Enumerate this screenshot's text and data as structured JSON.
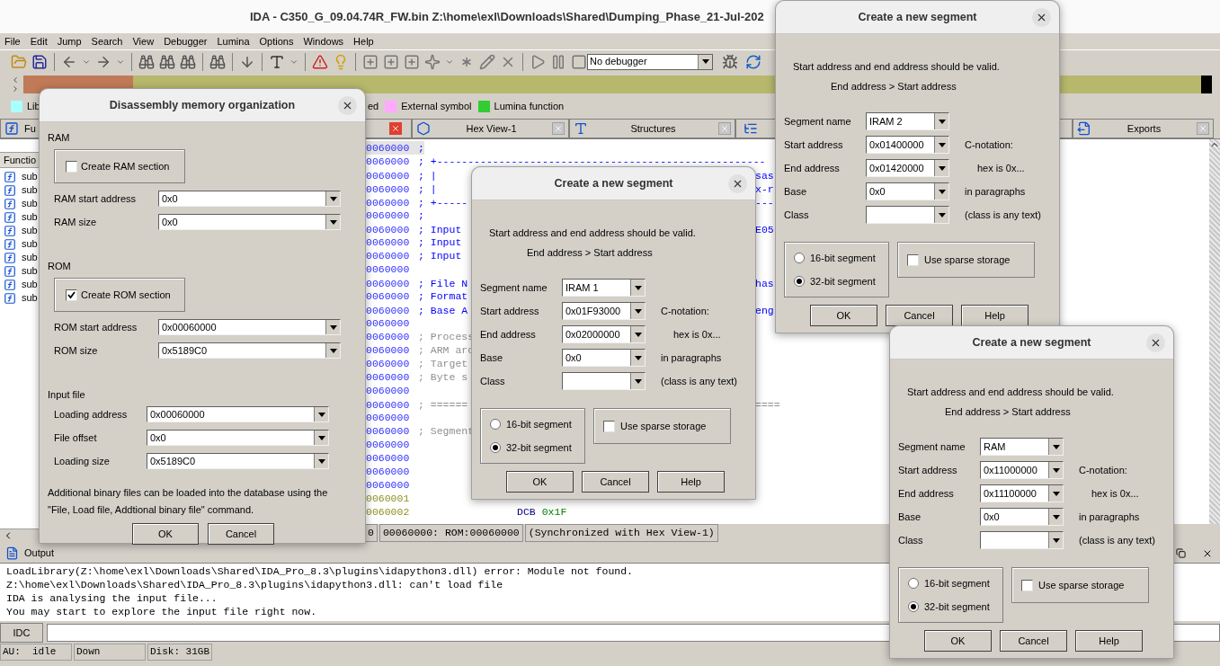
{
  "window": {
    "title": "IDA - C350_G_09.04.74R_FW.bin Z:\\home\\exl\\Downloads\\Shared\\Dumping_Phase_21-Jul-202"
  },
  "menu": [
    "File",
    "Edit",
    "Jump",
    "Search",
    "View",
    "Debugger",
    "Lumina",
    "Options",
    "Windows",
    "Help"
  ],
  "toolbar": {
    "debugger_select": "No debugger"
  },
  "legend": [
    {
      "label": "Lib",
      "color": "#aaffff"
    },
    {
      "label": "ed"
    },
    {
      "label": "External symbol",
      "color": "#ffaaff"
    },
    {
      "label": "Lumina function",
      "color": "#33cc33"
    }
  ],
  "tabs": [
    {
      "label": "Fu"
    },
    {
      "label": "Hex View-1"
    },
    {
      "label": "Structures"
    },
    {
      "label": "Exports"
    }
  ],
  "functions": {
    "header": "Functio",
    "rows": [
      "sub",
      "sub",
      "sub",
      "sub",
      "sub",
      "sub",
      "sub",
      "sub",
      "sub",
      "sub"
    ]
  },
  "code_lines": [
    {
      "kind": "comment",
      "address": "0060000",
      "text": ";",
      "selected": true
    },
    {
      "kind": "comment",
      "address": "0060000",
      "text": "; +-----------------------------------------------------",
      "selected": false
    },
    {
      "kind": "comment",
      "address": "0060000",
      "text": "; |",
      "right": "sas",
      "selected": false
    },
    {
      "kind": "comment",
      "address": "0060000",
      "text": "; |",
      "right": "x-r",
      "selected": false
    },
    {
      "kind": "comment",
      "address": "0060000",
      "text": "; +-----",
      "right": "---",
      "selected": false
    },
    {
      "kind": "comment",
      "address": "0060000",
      "text": ";",
      "selected": false
    },
    {
      "kind": "comment",
      "address": "0060000",
      "text": "; Input",
      "right": "E05",
      "selected": false
    },
    {
      "kind": "comment",
      "address": "0060000",
      "text": "; Input",
      "selected": false
    },
    {
      "kind": "comment",
      "address": "0060000",
      "text": "; Input",
      "selected": false
    },
    {
      "kind": "comment",
      "address": "0060000",
      "selected": false
    },
    {
      "kind": "comment",
      "address": "0060000",
      "text": "; File N",
      "right": "has",
      "selected": false
    },
    {
      "kind": "comment",
      "address": "0060000",
      "text": "; Format",
      "selected": false
    },
    {
      "kind": "comment",
      "address": "0060000",
      "text": "; Base A",
      "right": "eng",
      "selected": false
    },
    {
      "kind": "comment",
      "address": "0060000",
      "selected": false
    },
    {
      "kind": "note",
      "address": "0060000",
      "text": "; Process",
      "selected": false
    },
    {
      "kind": "note",
      "address": "0060000",
      "text": "; ARM arc",
      "selected": false
    },
    {
      "kind": "note",
      "address": "0060000",
      "text": "; Target",
      "selected": false
    },
    {
      "kind": "note",
      "address": "0060000",
      "text": "; Byte s",
      "selected": false
    },
    {
      "kind": "comment",
      "address": "0060000",
      "selected": false
    },
    {
      "kind": "note",
      "address": "0060000",
      "text": "; ======",
      "right": "====",
      "selected": false
    },
    {
      "kind": "comment",
      "address": "0060000",
      "selected": false
    },
    {
      "kind": "note",
      "address": "0060000",
      "text": "; Segment",
      "selected": false
    },
    {
      "kind": "comment",
      "address": "0060000",
      "selected": false
    },
    {
      "kind": "comment",
      "address": "0060000",
      "selected": false
    },
    {
      "kind": "comment",
      "address": "0060000",
      "selected": false
    },
    {
      "kind": "comment",
      "address": "0060000",
      "selected": false
    },
    {
      "kind": "data",
      "address": "0060001",
      "selected": false
    },
    {
      "kind": "data",
      "address": "0060002",
      "mnemonic": "DCB",
      "operand": "0x1F",
      "selected": false
    }
  ],
  "code_status": [
    "0",
    "00060000: ROM:00060000",
    "(Synchronized with Hex View-1)"
  ],
  "output": {
    "title": "Output",
    "lines": [
      "LoadLibrary(Z:\\home\\exl\\Downloads\\Shared\\IDA_Pro_8.3\\plugins\\idapython3.dll) error: Module not found.",
      "Z:\\home\\exl\\Downloads\\Shared\\IDA_Pro_8.3\\plugins\\idapython3.dll: can't load file",
      "IDA is analysing the input file...",
      "You may start to explore the input file right now."
    ],
    "command_button": "IDC"
  },
  "status_bar": [
    "AU:  idle",
    "Down",
    "Disk: 31GB"
  ],
  "memory_dialog": {
    "title": "Disassembly memory organization",
    "sections": [
      {
        "heading": "RAM",
        "checkbox": {
          "label": "Create RAM section",
          "checked": false
        },
        "fields": [
          {
            "label": "RAM start address",
            "value": "0x0"
          },
          {
            "label": "RAM size",
            "value": "0x0"
          }
        ]
      },
      {
        "heading": "ROM",
        "checkbox": {
          "label": "Create ROM section",
          "checked": true
        },
        "fields": [
          {
            "label": "ROM start address",
            "value": "0x00060000"
          },
          {
            "label": "ROM size",
            "value": "0x5189C0"
          }
        ]
      },
      {
        "heading": "Input file",
        "fields": [
          {
            "label": "Loading address",
            "value": "0x00060000"
          },
          {
            "label": "File offset",
            "value": "0x0"
          },
          {
            "label": "Loading size",
            "value": "0x5189C0"
          }
        ]
      }
    ],
    "note": "Additional binary files can be loaded into the database using the \"File, Load file, Addtional binary file\" command.",
    "buttons": [
      "OK",
      "Cancel"
    ]
  },
  "segment_dialogs": [
    {
      "title": "Create a new segment",
      "hints": [
        "Start address and end address should be valid.",
        "End address > Start address"
      ],
      "fields": [
        {
          "label": "Segment name",
          "value": "IRAM 1"
        },
        {
          "label": "Start address",
          "value": "0x01F93000",
          "note": "C-notation:"
        },
        {
          "label": "End address",
          "value": "0x02000000",
          "note": "hex is 0x..."
        },
        {
          "label": "Base",
          "value": "0x0",
          "note": "in paragraphs"
        },
        {
          "label": "Class",
          "note": "(class is any text)"
        }
      ],
      "radios": [
        {
          "label": "16-bit segment",
          "selected": false
        },
        {
          "label": "32-bit segment",
          "selected": true
        }
      ],
      "sparse": {
        "label": "Use sparse storage",
        "checked": false
      },
      "buttons": [
        "OK",
        "Cancel",
        "Help"
      ]
    },
    {
      "title": "Create a new segment",
      "hints": [
        "Start address and end address should be valid.",
        "End address > Start address"
      ],
      "fields": [
        {
          "label": "Segment name",
          "value": "IRAM 2"
        },
        {
          "label": "Start address",
          "value": "0x01400000",
          "note": "C-notation:"
        },
        {
          "label": "End address",
          "value": "0x01420000",
          "note": "hex is 0x..."
        },
        {
          "label": "Base",
          "value": "0x0",
          "note": "in paragraphs"
        },
        {
          "label": "Class",
          "note": "(class is any text)"
        }
      ],
      "radios": [
        {
          "label": "16-bit segment",
          "selected": false
        },
        {
          "label": "32-bit segment",
          "selected": true
        }
      ],
      "sparse": {
        "label": "Use sparse storage",
        "checked": false
      },
      "buttons": [
        "OK",
        "Cancel",
        "Help"
      ]
    },
    {
      "title": "Create a new segment",
      "hints": [
        "Start address and end address should be valid.",
        "End address > Start address"
      ],
      "fields": [
        {
          "label": "Segment name",
          "value": "RAM"
        },
        {
          "label": "Start address",
          "value": "0x11000000",
          "note": "C-notation:"
        },
        {
          "label": "End address",
          "value": "0x11100000",
          "note": "hex is 0x..."
        },
        {
          "label": "Base",
          "value": "0x0",
          "note": "in paragraphs"
        },
        {
          "label": "Class",
          "note": "(class is any text)"
        }
      ],
      "radios": [
        {
          "label": "16-bit segment",
          "selected": false
        },
        {
          "label": "32-bit segment",
          "selected": true
        }
      ],
      "sparse": {
        "label": "Use sparse storage",
        "checked": false
      },
      "buttons": [
        "OK",
        "Cancel",
        "Help"
      ]
    }
  ]
}
